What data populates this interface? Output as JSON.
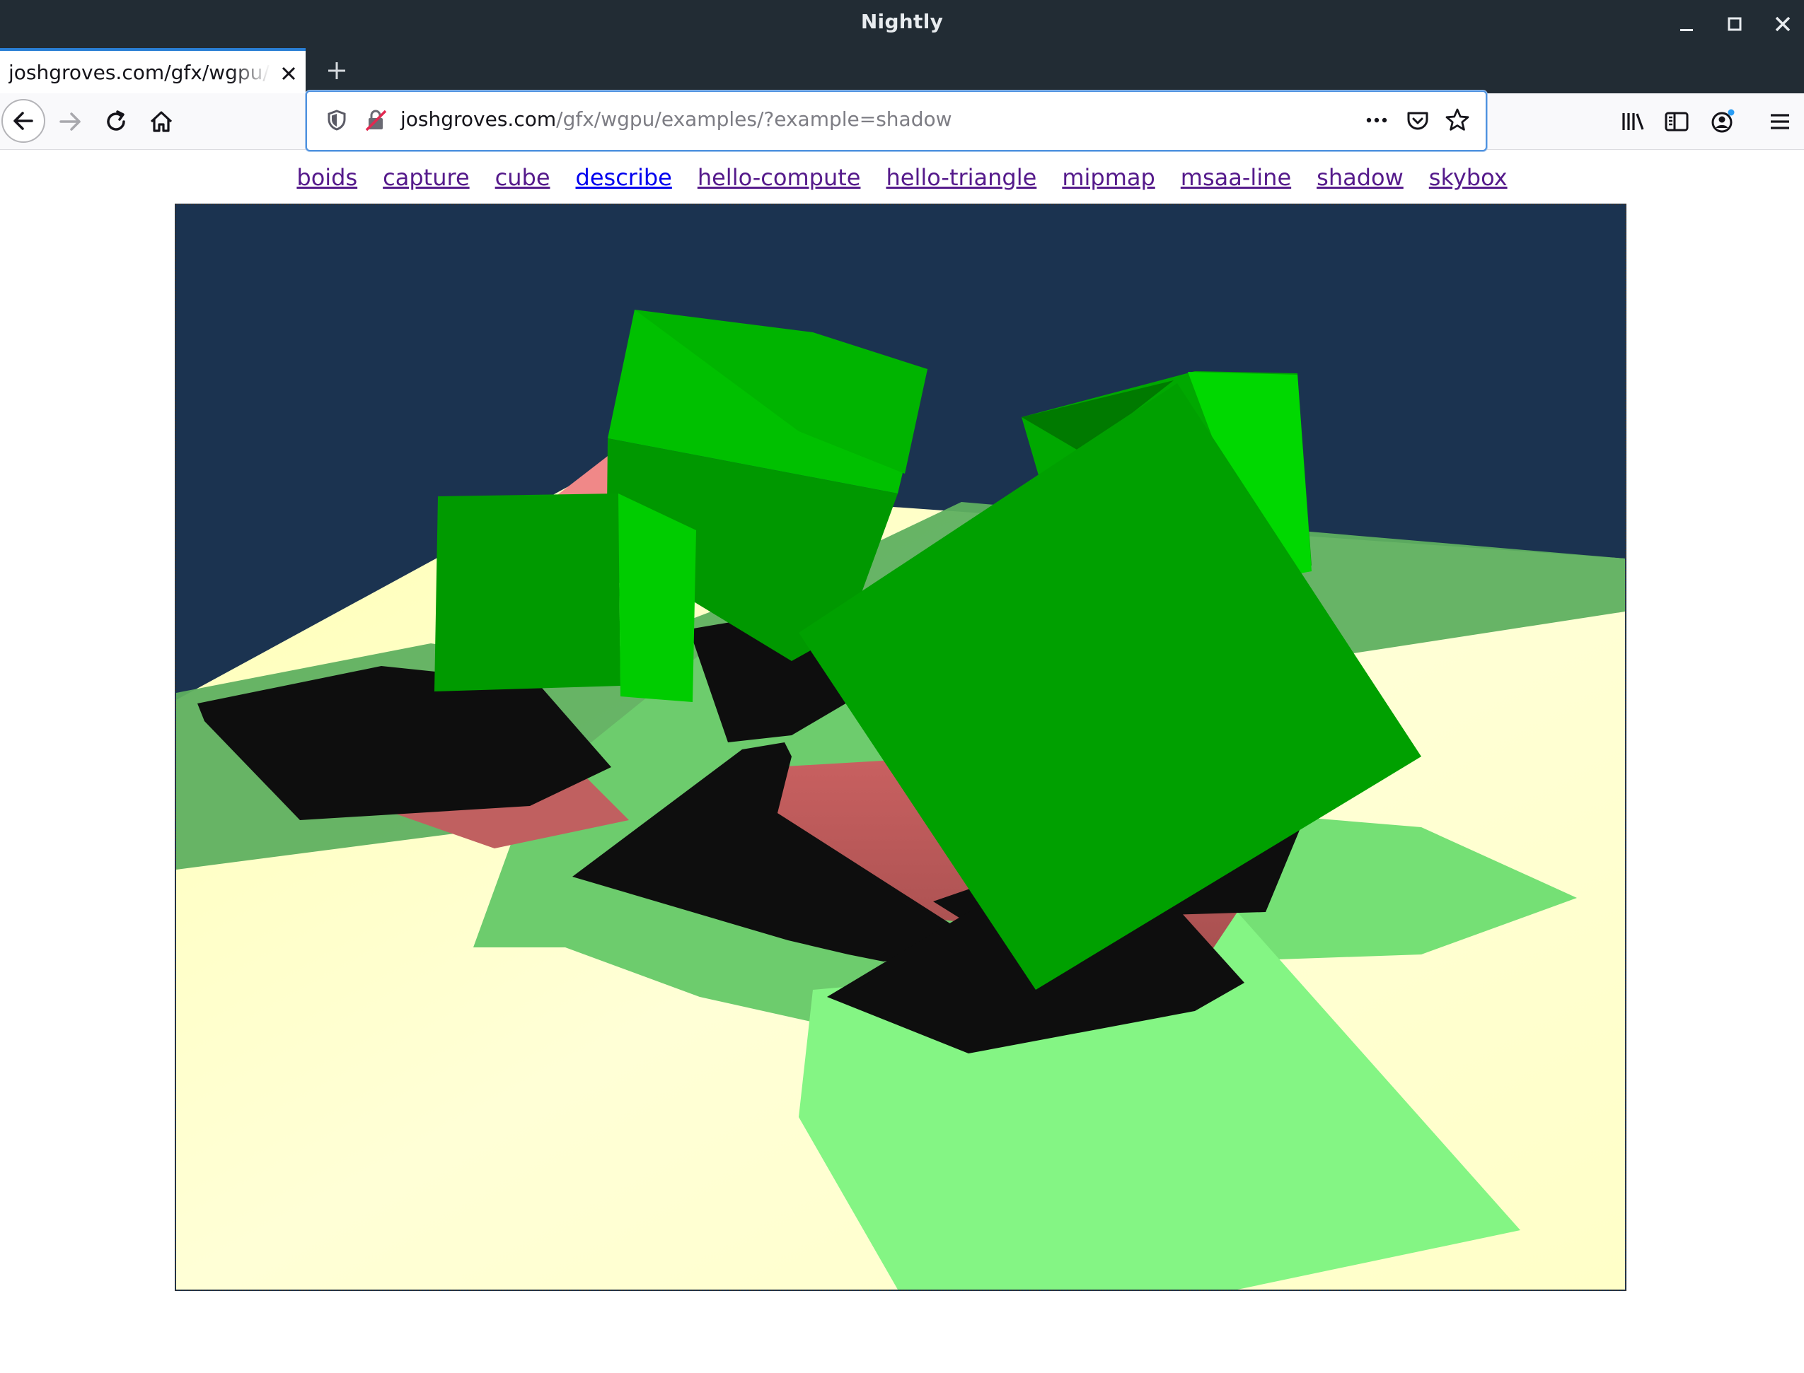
{
  "window": {
    "title": "Nightly"
  },
  "tab": {
    "title": "joshgroves.com/gfx/wgpu/examples/?example=shadow"
  },
  "urlbar": {
    "domain": "joshgroves.com",
    "path": "/gfx/wgpu/examples/?example=shadow"
  },
  "icons": {
    "minimize": "minimize-icon",
    "maximize": "maximize-icon",
    "close": "close-icon",
    "back": "back-arrow-icon",
    "forward": "forward-arrow-icon",
    "reload": "reload-icon",
    "home": "home-icon",
    "shield": "tracking-protection-shield-icon",
    "insecure": "insecure-lock-icon",
    "more": "page-actions-more-icon",
    "pocket": "pocket-icon",
    "bookmark": "bookmark-star-icon",
    "library": "library-icon",
    "sidebar": "sidebar-icon",
    "account": "account-icon",
    "menu": "hamburger-menu-icon"
  },
  "colors": {
    "titlebar": "#222c34",
    "accent": "#2a7fd4",
    "link_visited": "#551a8b",
    "link_unvisited": "#0000ee",
    "sky": "#1b3350",
    "floor": "#ffffc0",
    "cube": "#00a000",
    "shadow": "#0d0d0d",
    "red_shape": "#c05a5a"
  },
  "examples": [
    {
      "label": "boids",
      "visited": true
    },
    {
      "label": "capture",
      "visited": true
    },
    {
      "label": "cube",
      "visited": true
    },
    {
      "label": "describe",
      "visited": false
    },
    {
      "label": "hello-compute",
      "visited": true
    },
    {
      "label": "hello-triangle",
      "visited": true
    },
    {
      "label": "mipmap",
      "visited": true
    },
    {
      "label": "msaa-line",
      "visited": true
    },
    {
      "label": "shadow",
      "visited": true
    },
    {
      "label": "skybox",
      "visited": true
    }
  ]
}
